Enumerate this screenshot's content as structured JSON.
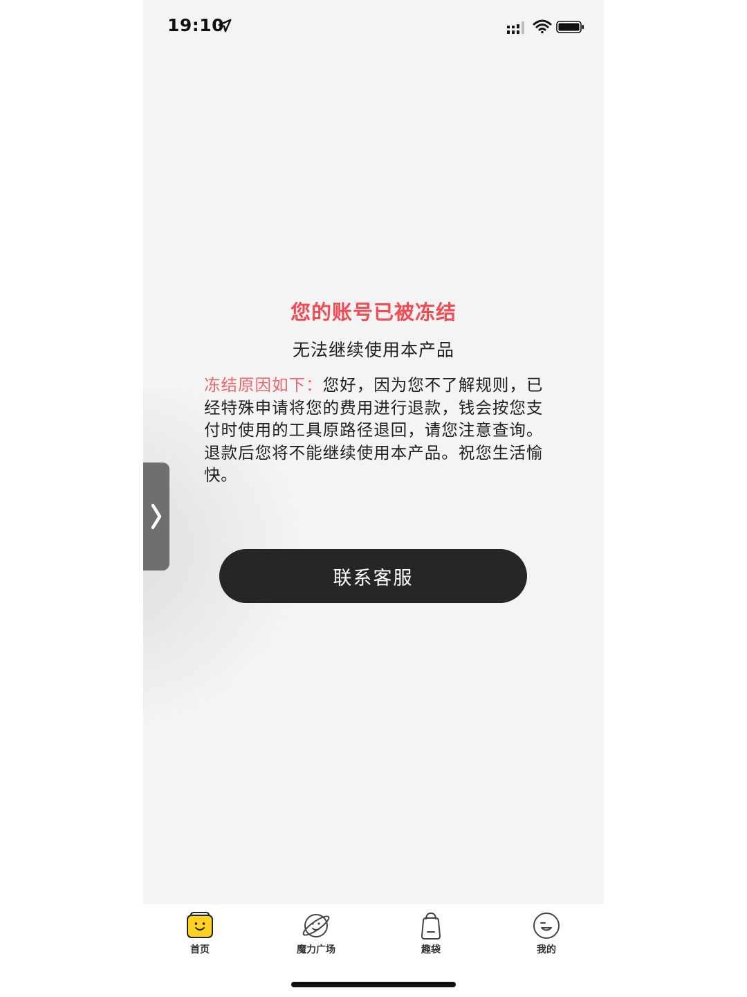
{
  "status_bar": {
    "time": "19:10",
    "icons": [
      "location-arrow-icon",
      "cellular-signal-icon",
      "wifi-icon",
      "battery-icon"
    ]
  },
  "side_handle": {
    "icon": "chevron-right-icon"
  },
  "main": {
    "title": "您的账号已被冻结",
    "subtitle": "无法继续使用本产品",
    "reason_label": "冻结原因如下：",
    "reason_text": "您好，因为您不了解规则，已经特殊申请将您的费用进行退款，钱会按您支付时使用的工具原路径退回，请您注意查询。退款后您将不能继续使用本产品。祝您生活愉快。",
    "contact_button": "联系客服"
  },
  "tab_bar": {
    "items": [
      {
        "label": "首页",
        "icon": "smiley-box-icon",
        "active": true
      },
      {
        "label": "魔力广场",
        "icon": "planet-icon",
        "active": false
      },
      {
        "label": "趣袋",
        "icon": "bag-icon",
        "active": false
      },
      {
        "label": "我的",
        "icon": "smiley-face-icon",
        "active": false
      }
    ]
  },
  "colors": {
    "accent_red": "#f24b55",
    "button_dark": "#262626",
    "tab_active_yellow": "#ffd21f"
  }
}
